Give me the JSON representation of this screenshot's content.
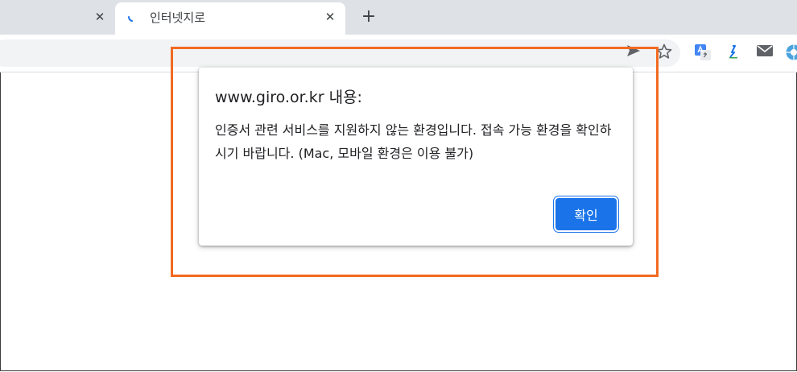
{
  "browser": {
    "tabs": [
      {
        "title": ""
      },
      {
        "title": "인터넷지로",
        "active": true,
        "loading": true
      }
    ],
    "close_glyph": "✕",
    "new_tab_glyph": "+",
    "toolbar_icons": [
      "send-icon",
      "star-icon",
      "google-translate-extension-icon",
      "extension-icon",
      "mail-icon",
      "globe-extension-icon"
    ]
  },
  "dialog": {
    "title": "www.giro.or.kr 내용:",
    "message": "인증서 관련 서비스를 지원하지 않는 환경입니다. 접속 가능 환경을 확인하시기 바랍니다. (Mac, 모바일 환경은 이용 불가)",
    "ok_label": "확인"
  },
  "colors": {
    "highlight": "#f26a21",
    "primary_button": "#1a73e8",
    "tab_strip": "#dee1e6"
  }
}
